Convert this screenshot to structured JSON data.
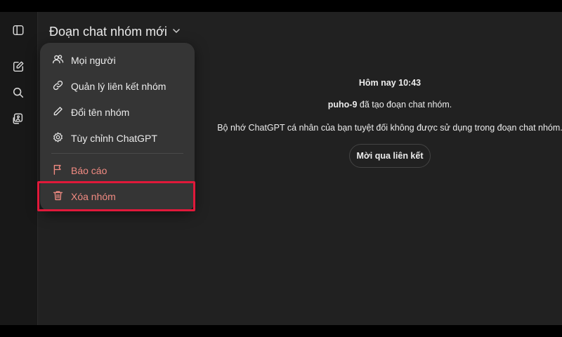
{
  "header": {
    "title": "Đoạn chat nhóm mới"
  },
  "sidebar": {
    "icons": [
      "sidebar-toggle-icon",
      "new-chat-icon",
      "search-icon",
      "library-icon"
    ]
  },
  "menu": {
    "items": [
      {
        "label": "Mọi người",
        "icon": "people-icon"
      },
      {
        "label": "Quản lý liên kết nhóm",
        "icon": "link-icon"
      },
      {
        "label": "Đổi tên nhóm",
        "icon": "pencil-icon"
      },
      {
        "label": "Tùy chỉnh ChatGPT",
        "icon": "gear-icon"
      }
    ],
    "danger_items": [
      {
        "label": "Báo cáo",
        "icon": "flag-icon"
      },
      {
        "label": "Xóa nhóm",
        "icon": "trash-icon"
      }
    ]
  },
  "chat": {
    "timestamp": "Hôm nay 10:43",
    "creator_name": "puho-9",
    "creator_action": "đã tạo đoạn chat nhóm.",
    "memory_notice": "Bộ nhớ ChatGPT cá nhân của bạn tuyệt đối không được sử dụng trong đoạn chat nhóm.",
    "invite_label": "Mời qua liên kết"
  },
  "colors": {
    "background": "#212121",
    "sidebar": "#181818",
    "menu": "#353535",
    "danger": "#f28b82",
    "highlight": "#e0193a"
  }
}
